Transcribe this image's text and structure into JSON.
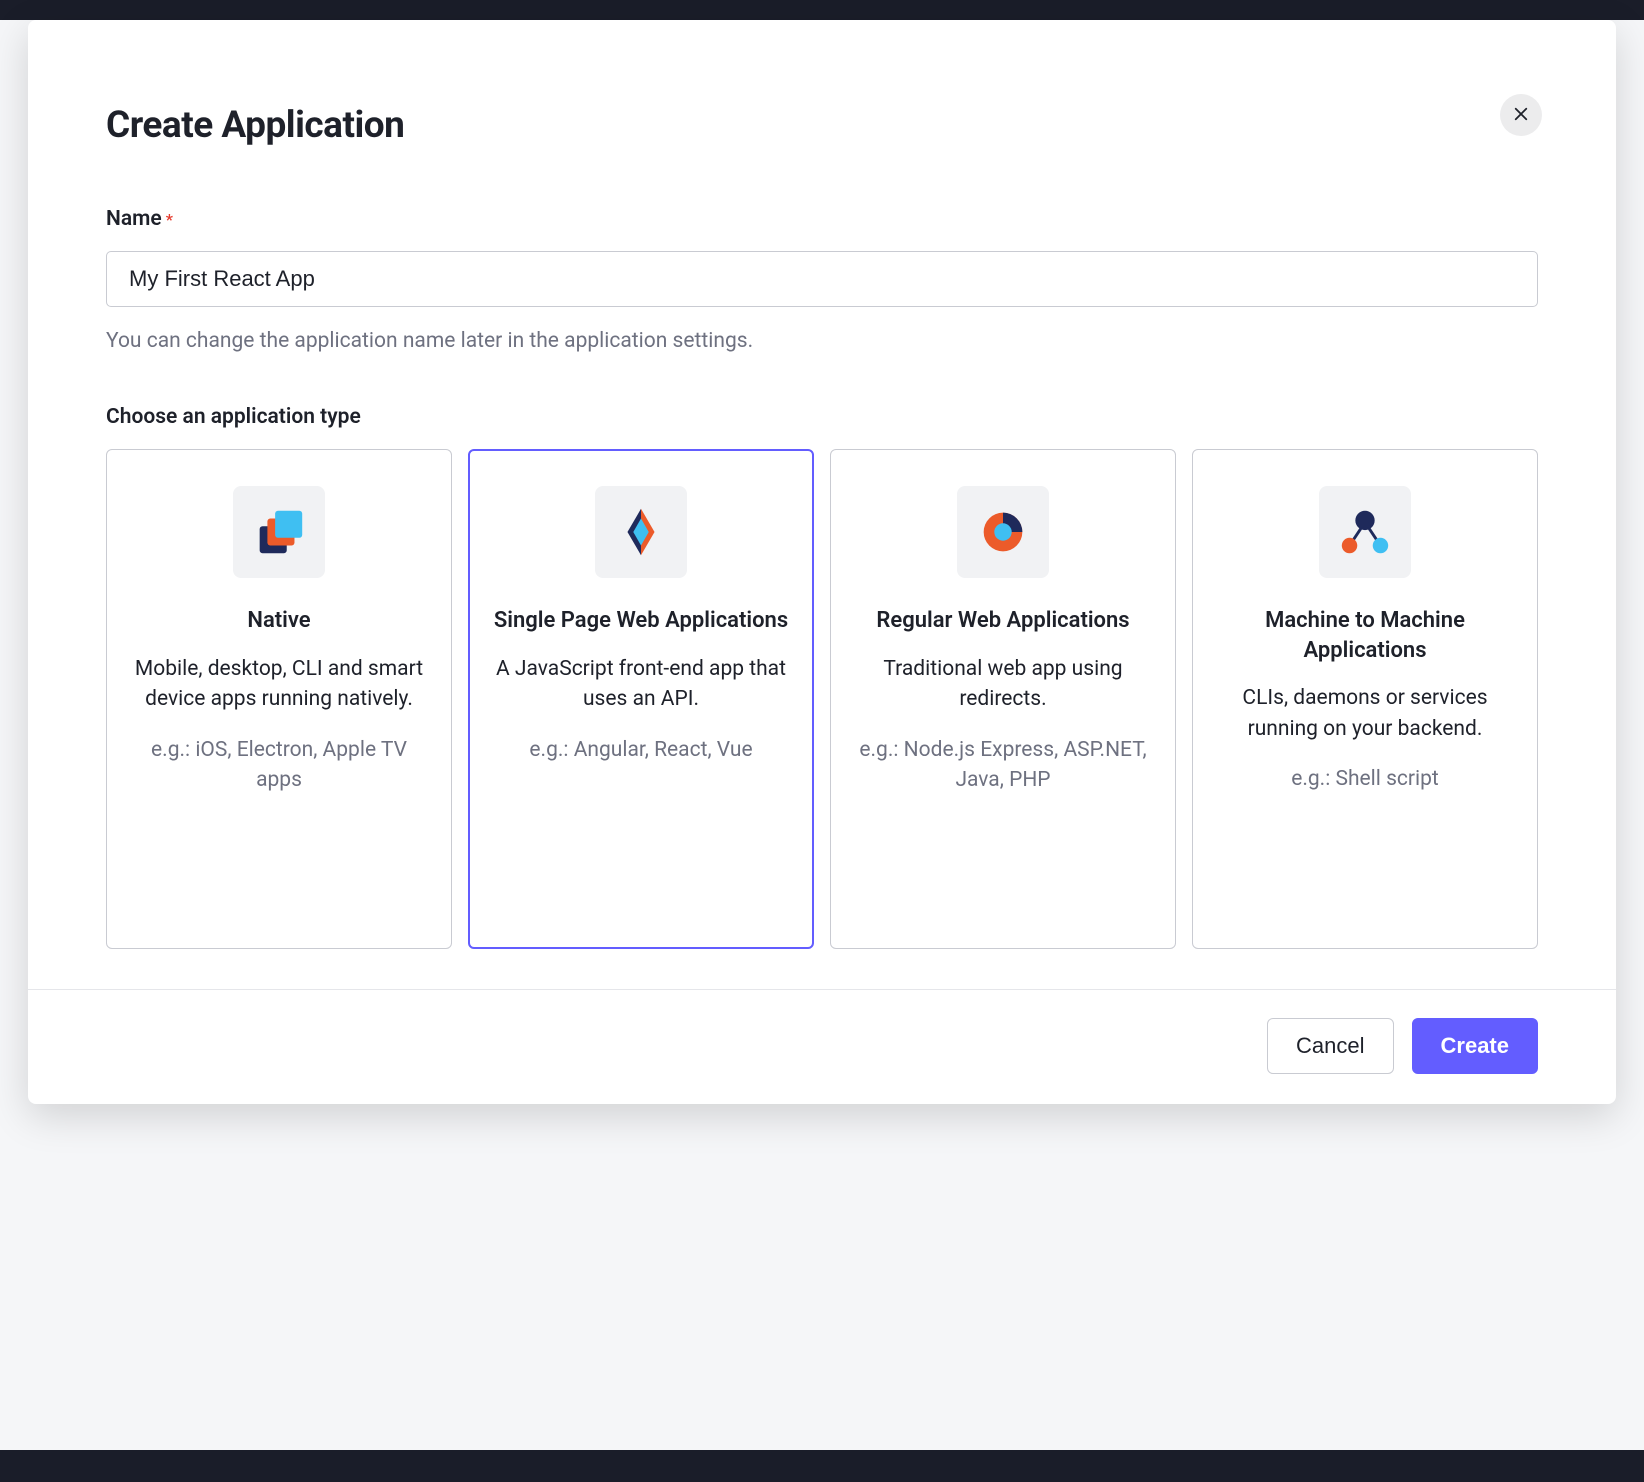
{
  "modal": {
    "title": "Create Application",
    "nameField": {
      "label": "Name",
      "required": "*",
      "value": "My First React App",
      "hint": "You can change the application name later in the application settings."
    },
    "typeSection": {
      "label": "Choose an application type",
      "selectedIndex": 1,
      "options": [
        {
          "title": "Native",
          "description": "Mobile, desktop, CLI and smart device apps running natively.",
          "example": "e.g.: iOS, Electron, Apple TV apps"
        },
        {
          "title": "Single Page Web Applications",
          "description": "A JavaScript front-end app that uses an API.",
          "example": "e.g.: Angular, React, Vue"
        },
        {
          "title": "Regular Web Applications",
          "description": "Traditional web app using redirects.",
          "example": "e.g.: Node.js Express, ASP.NET, Java, PHP"
        },
        {
          "title": "Machine to Machine Applications",
          "description": "CLIs, daemons or services running on your backend.",
          "example": "e.g.: Shell script"
        }
      ]
    },
    "footer": {
      "cancel": "Cancel",
      "create": "Create"
    }
  }
}
